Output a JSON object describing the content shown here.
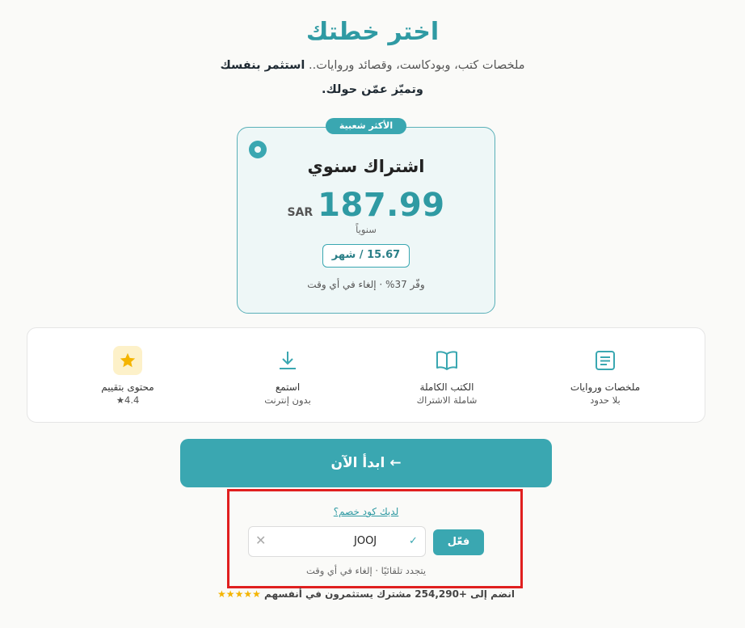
{
  "header": {
    "title": "اختر خطتك",
    "subtitle_prefix": "ملخصات كتب، وبودكاست، وقصائد وروايات..",
    "subtitle_bold": "استثمر بنفسك",
    "subtitle_line2": "وتميّز عمّن حولك."
  },
  "plan": {
    "badge": "الأكثر شعبية",
    "name": "اشتراك سنوي",
    "currency": "SAR",
    "price": "187.99",
    "period": "سنوياً",
    "monthly": "15.67 / شهر",
    "savings": "وفّر 37% · إلغاء في أي وقت"
  },
  "features": [
    {
      "title": "ملخصات وروايات",
      "sub": "بلا حدود",
      "icon": "document-icon"
    },
    {
      "title": "الكتب الكاملة",
      "sub": "شاملة الاشتراك",
      "icon": "book-icon"
    },
    {
      "title": "استمع",
      "sub": "بدون إنترنت",
      "icon": "download-icon"
    },
    {
      "title": "محتوى بتقييم",
      "sub": "★4.4",
      "icon": "star-icon"
    }
  ],
  "cta": {
    "label": "ابدأ الآن ←"
  },
  "promo": {
    "link": "لديك كود خصم؟",
    "code": "JOOJ",
    "apply": "فعّل",
    "renew": "يتجدد تلقائيًا · إلغاء في أي وقت"
  },
  "social": {
    "stars": "★★★★★",
    "text": "انضم إلى +254,290 مشترك يستثمرون في أنفسهم"
  },
  "colors": {
    "accent": "#3aa7b1",
    "title": "#2f9aa3",
    "highlight": "#e01f1f",
    "star": "#f4b400"
  }
}
